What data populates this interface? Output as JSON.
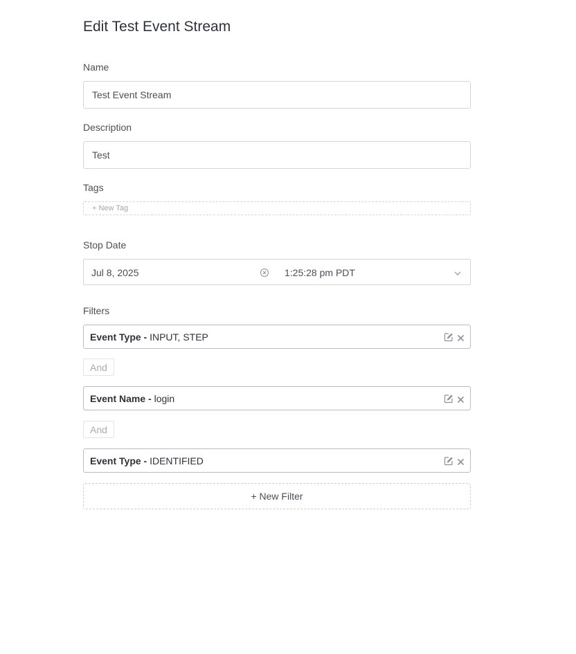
{
  "page": {
    "title": "Edit Test Event Stream"
  },
  "form": {
    "name": {
      "label": "Name",
      "value": "Test Event Stream"
    },
    "description": {
      "label": "Description",
      "value": "Test"
    },
    "tags": {
      "label": "Tags",
      "new_tag_label": "+ New Tag"
    },
    "stop_date": {
      "label": "Stop Date",
      "date": "Jul 8, 2025",
      "time": "1:25:28 pm PDT",
      "clear_icon": "circle-x-icon",
      "dropdown_icon": "chevron-down-icon"
    },
    "filters": {
      "label": "Filters",
      "items": [
        {
          "key": "Event Type -",
          "value": "INPUT, STEP"
        },
        {
          "key": "Event Name -",
          "value": "login"
        },
        {
          "key": "Event Type -",
          "value": "IDENTIFIED"
        }
      ],
      "connector": "And",
      "edit_icon": "pencil-square-icon",
      "remove_icon": "close-icon",
      "new_filter_label": "+ New Filter"
    }
  },
  "colors": {
    "border": "#d4d6da",
    "filter_border": "#b9bcc1",
    "text": "#2e3238",
    "muted_text": "#a7abb1",
    "background": "#ffffff"
  }
}
